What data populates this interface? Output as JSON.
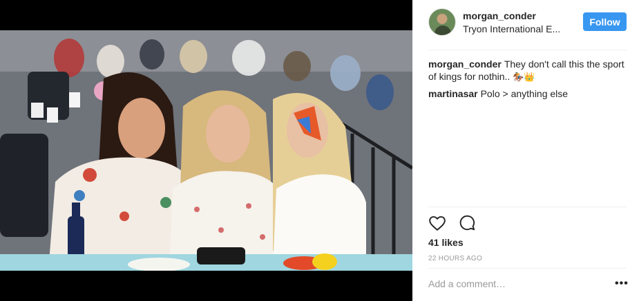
{
  "post": {
    "media": {
      "alt": ""
    },
    "header": {
      "username": "morgan_conder",
      "location": "Tryon International E...",
      "follow_label": "Follow",
      "avatar_icon": "profile-avatar"
    },
    "comments": [
      {
        "user": "morgan_conder",
        "text": "They don't call this the sport of kings for nothin..",
        "emoji": "🏇👑"
      },
      {
        "user": "martinasar",
        "text": "Polo > anything else",
        "emoji": ""
      }
    ],
    "actions": {
      "like_icon": "heart-icon",
      "comment_icon": "comment-bubble-icon"
    },
    "likes": "41 likes",
    "timestamp": "22 HOURS AGO",
    "add_comment_placeholder": "Add a comment…",
    "more_label": "•••"
  },
  "colors": {
    "accent": "#3897f0",
    "text": "#262626",
    "muted": "#999999",
    "divider": "#efefef"
  }
}
